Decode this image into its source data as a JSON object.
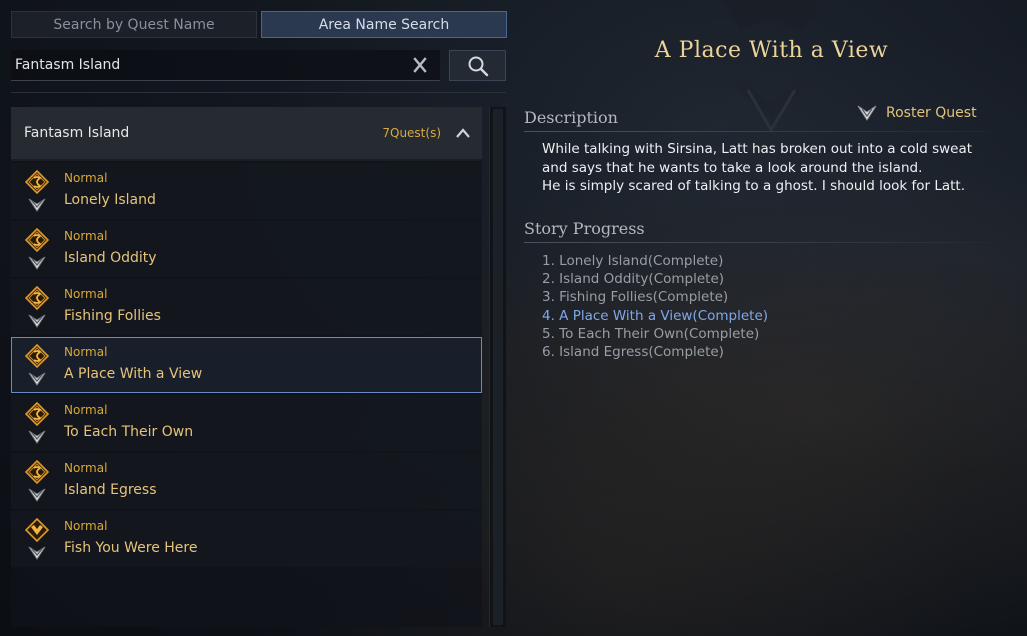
{
  "tabs": {
    "quest_name": "Search by Quest Name",
    "area_name": "Area Name Search",
    "active": "area_name"
  },
  "search": {
    "value": "Fantasm Island",
    "placeholder": ""
  },
  "quest_group": {
    "title": "Fantasm Island",
    "count": "7Quest(s)",
    "expanded": true
  },
  "quests": [
    {
      "grade": "Normal",
      "name": "Lonely Island",
      "icon": "story-quest-icon",
      "rank_icon": "roster-quest-icon"
    },
    {
      "grade": "Normal",
      "name": "Island Oddity",
      "icon": "story-quest-icon",
      "rank_icon": "roster-quest-icon"
    },
    {
      "grade": "Normal",
      "name": "Fishing Follies",
      "icon": "story-quest-icon",
      "rank_icon": "roster-quest-icon"
    },
    {
      "grade": "Normal",
      "name": "A Place With a View",
      "icon": "story-quest-icon",
      "rank_icon": "roster-quest-icon",
      "selected": true
    },
    {
      "grade": "Normal",
      "name": "To Each Their Own",
      "icon": "story-quest-icon",
      "rank_icon": "roster-quest-icon"
    },
    {
      "grade": "Normal",
      "name": "Island Egress",
      "icon": "story-quest-icon",
      "rank_icon": "roster-quest-icon"
    },
    {
      "grade": "Normal",
      "name": "Fish You Were Here",
      "icon": "special-quest-icon",
      "rank_icon": "roster-quest-icon"
    }
  ],
  "detail": {
    "title": "A Place With a View",
    "description_label": "Description",
    "quest_type": "Roster Quest",
    "description_lines": [
      "While talking with Sirsina, Latt has broken out into a cold sweat",
      "and says that he wants to take a look around the island.",
      "He is simply scared of talking to a ghost. I should look for Latt."
    ],
    "progress_label": "Story Progress",
    "progress": [
      {
        "text": "1. Lonely Island(Complete)",
        "current": false
      },
      {
        "text": "2. Island Oddity(Complete)",
        "current": false
      },
      {
        "text": "3. Fishing Follies(Complete)",
        "current": false
      },
      {
        "text": "4. A Place With a View(Complete)",
        "current": true
      },
      {
        "text": "5. To Each Their Own(Complete)",
        "current": false
      },
      {
        "text": "6. Island Egress(Complete)",
        "current": false
      }
    ]
  },
  "colors": {
    "accent_blue": "#6a8cbc",
    "quest_name_gold": "#e5c47a",
    "grade_gold": "#d8a83a",
    "current_step_blue": "#7fa8e8"
  }
}
